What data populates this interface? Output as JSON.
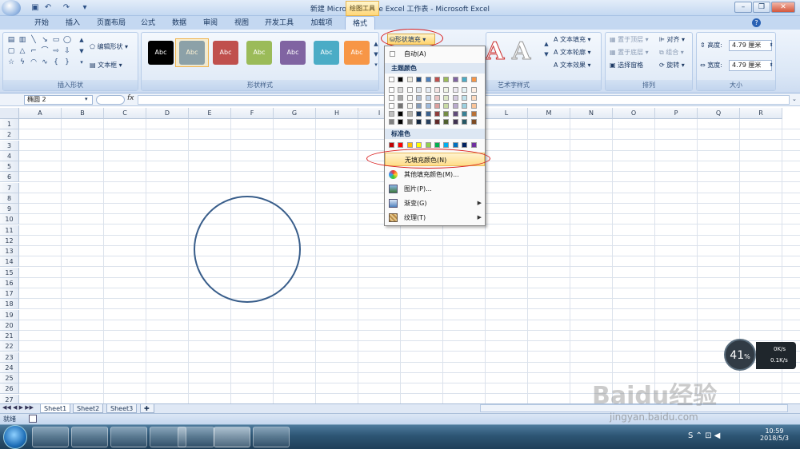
{
  "title": "新建 Microsoft Office Excel 工作表 - Microsoft Excel",
  "contextual_tab": "绘图工具",
  "tabs": [
    "开始",
    "插入",
    "页面布局",
    "公式",
    "数据",
    "审阅",
    "视图",
    "开发工具",
    "加载项",
    "格式"
  ],
  "ribbon": {
    "insert_shapes": {
      "label": "插入形状",
      "edit_shape": "编辑形状",
      "text_box": "文本框"
    },
    "shape_styles": {
      "label": "形状样式",
      "styles": [
        {
          "text": "Abc",
          "color": "#000000"
        },
        {
          "text": "Abc",
          "color": "#4f81bd"
        },
        {
          "text": "Abc",
          "color": "#c0504d"
        },
        {
          "text": "Abc",
          "color": "#9bbb59"
        },
        {
          "text": "Abc",
          "color": "#8064a2"
        },
        {
          "text": "Abc",
          "color": "#4bacc6"
        },
        {
          "text": "Abc",
          "color": "#f79646"
        }
      ],
      "shape_fill": "形状填充"
    },
    "wordart": {
      "label": "艺术字样式",
      "text_fill": "文本填充",
      "text_outline": "文本轮廓",
      "text_effects": "文本效果"
    },
    "arrange": {
      "label": "排列",
      "bring_front": "置于顶层",
      "send_back": "置于底层",
      "selection_pane": "选择窗格",
      "align": "对齐",
      "group": "组合",
      "rotate": "旋转"
    },
    "size": {
      "label": "大小",
      "height_label": "高度:",
      "height": "4.79 厘米",
      "width_label": "宽度:",
      "width": "4.79 厘米"
    }
  },
  "name_box": "椭圆 2",
  "fx": "fx",
  "columns": [
    "A",
    "B",
    "C",
    "D",
    "E",
    "F",
    "G",
    "H",
    "I",
    "J",
    "K",
    "L",
    "M",
    "N",
    "O",
    "P",
    "Q",
    "R"
  ],
  "rows": [
    "1",
    "2",
    "3",
    "4",
    "5",
    "6",
    "7",
    "8",
    "9",
    "10",
    "11",
    "12",
    "13",
    "14",
    "15",
    "16",
    "17",
    "18",
    "19",
    "20",
    "21",
    "22",
    "23",
    "24",
    "25",
    "26",
    "27"
  ],
  "fill_menu": {
    "auto": "自动(A)",
    "theme_colors": "主题颜色",
    "standard_colors": "标准色",
    "theme_row": [
      "#ffffff",
      "#000000",
      "#eeece1",
      "#1f497d",
      "#4f81bd",
      "#c0504d",
      "#9bbb59",
      "#8064a2",
      "#4bacc6",
      "#f79646"
    ],
    "standard_row": [
      "#c00000",
      "#ff0000",
      "#ffc000",
      "#ffff00",
      "#92d050",
      "#00b050",
      "#00b0f0",
      "#0070c0",
      "#002060",
      "#7030a0"
    ],
    "no_fill": "无填充颜色(N)",
    "more_colors": "其他填充颜色(M)...",
    "picture": "图片(P)...",
    "gradient": "渐变(G)",
    "texture": "纹理(T)"
  },
  "sheets": [
    "Sheet1",
    "Sheet2",
    "Sheet3"
  ],
  "status": "就绪",
  "tray": {
    "percent": "41",
    "percent_unit": "%",
    "up": "0K/s",
    "down": "0.1K/s",
    "time": "10:59",
    "date": "2018/5/3"
  },
  "watermark": {
    "brand": "Baidu经验",
    "url": "jingyan.baidu.com"
  }
}
